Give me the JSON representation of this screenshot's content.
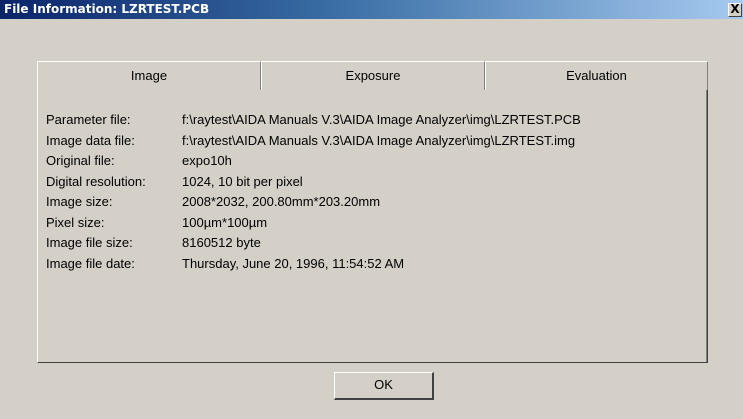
{
  "window": {
    "title": "File Information: LZRTEST.PCB",
    "close_label": "X"
  },
  "tabs": [
    {
      "label": "Image",
      "active": true
    },
    {
      "label": "Exposure",
      "active": false
    },
    {
      "label": "Evaluation",
      "active": false
    }
  ],
  "fields": [
    {
      "label": "Parameter file:",
      "value": "f:\\raytest\\AIDA Manuals V.3\\AIDA Image Analyzer\\img\\LZRTEST.PCB"
    },
    {
      "label": "Image data file:",
      "value": "f:\\raytest\\AIDA Manuals V.3\\AIDA Image Analyzer\\img\\LZRTEST.img"
    },
    {
      "label": "Original file:",
      "value": "expo10h"
    },
    {
      "label": "Digital resolution:",
      "value": "1024, 10 bit per pixel"
    },
    {
      "label": "Image size:",
      "value": "2008*2032, 200.80mm*203.20mm"
    },
    {
      "label": "Pixel size:",
      "value": "100µm*100µm"
    },
    {
      "label": "Image file size:",
      "value": "8160512 byte"
    },
    {
      "label": "Image file date:",
      "value": "Thursday, June 20, 1996, 11:54:52  AM"
    }
  ],
  "buttons": {
    "ok_label": "OK"
  }
}
